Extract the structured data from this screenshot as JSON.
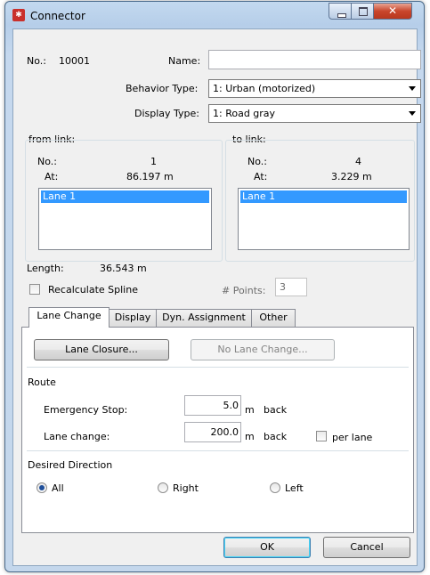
{
  "window": {
    "title": "Connector",
    "close_glyph": "✕"
  },
  "header": {
    "no_label": "No.:",
    "no_value": "10001",
    "name_label": "Name:",
    "name_value": "",
    "behavior_label": "Behavior Type:",
    "behavior_value": "1: Urban (motorized)",
    "display_label": "Display Type:",
    "display_value": "1: Road gray"
  },
  "from_link": {
    "title": "from link:",
    "no_label": "No.:",
    "no_value": "1",
    "at_label": "At:",
    "at_value": "86.197 m",
    "lanes": [
      "Lane 1"
    ]
  },
  "to_link": {
    "title": "to link:",
    "no_label": "No.:",
    "no_value": "4",
    "at_label": "At:",
    "at_value": "3.229 m",
    "lanes": [
      "Lane 1"
    ]
  },
  "length": {
    "label": "Length:",
    "value": "36.543 m"
  },
  "recalc": {
    "label": "Recalculate Spline",
    "checked": false
  },
  "points": {
    "label": "# Points:",
    "value": "3"
  },
  "tabs": [
    {
      "label": "Lane Change",
      "active": true
    },
    {
      "label": "Display",
      "active": false
    },
    {
      "label": "Dyn. Assignment",
      "active": false
    },
    {
      "label": "Other",
      "active": false
    }
  ],
  "lane_change": {
    "lane_closure_button": "Lane Closure...",
    "no_lane_change_button": "No Lane Change...",
    "route_title": "Route",
    "emergency_label": "Emergency Stop:",
    "emergency_value": "5.0",
    "emergency_unit": "m",
    "emergency_back": "back",
    "lanechange_label": "Lane change:",
    "lanechange_value": "200.0",
    "lanechange_unit": "m",
    "lanechange_back": "back",
    "per_lane_label": "per lane",
    "desired_title": "Desired Direction",
    "dir_all": "All",
    "dir_right": "Right",
    "dir_left": "Left",
    "selected_direction": "All"
  },
  "footer": {
    "ok": "OK",
    "cancel": "Cancel"
  },
  "colors": {
    "accent": "#3399ff",
    "title_bar": "#c3d9ef",
    "close": "#c9462c"
  }
}
